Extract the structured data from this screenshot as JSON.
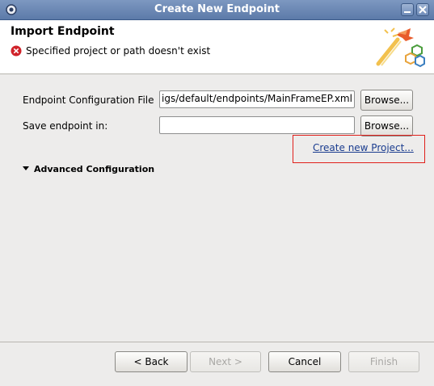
{
  "window": {
    "title": "Create New Endpoint"
  },
  "header": {
    "title": "Import Endpoint",
    "error_message": "Specified project or path doesn't exist"
  },
  "form": {
    "config_file_label": "Endpoint Configuration File",
    "config_file_value": "igs/default/endpoints/MainFrameEP.xml",
    "save_in_label": "Save endpoint in:",
    "save_in_value": "",
    "browse_label_1": "Browse...",
    "browse_label_2": "Browse...",
    "create_project_link": "Create new Project...",
    "advanced_label": "Advanced Configuration"
  },
  "buttons": {
    "back": "< Back",
    "next": "Next >",
    "cancel": "Cancel",
    "finish": "Finish"
  },
  "colors": {
    "titlebar": "#5c7aa9",
    "error_icon": "#d0232a",
    "link": "#1a3c8f",
    "highlight_border": "#e0201b"
  }
}
